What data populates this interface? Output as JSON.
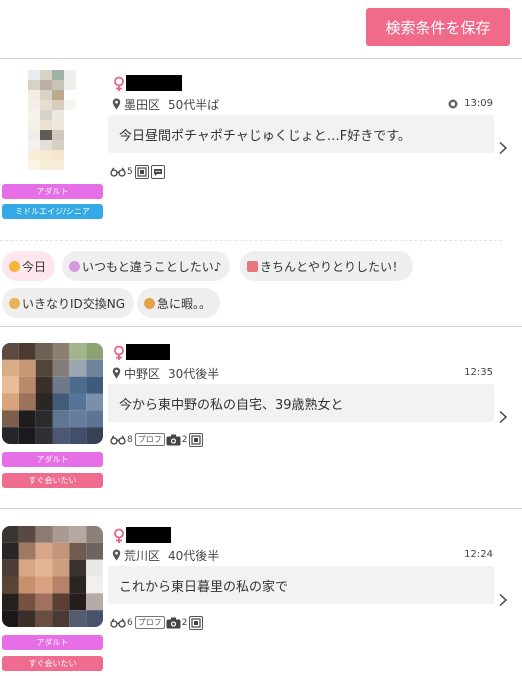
{
  "header": {
    "save_label": "検索条件を保存"
  },
  "posts": [
    {
      "location": "墨田区",
      "age": "50代半ば",
      "time": "13:09",
      "message": "今日昼間ポチャポチャじゅくじょと…F好きです。",
      "stats": {
        "glasses_count": "5"
      },
      "badges": [
        "アダルト",
        "ミドルエイジ/シニア"
      ]
    },
    {
      "location": "中野区",
      "age": "30代後半",
      "time": "12:35",
      "message": "今から東中野の私の自宅、39歳熟女と",
      "stats": {
        "glasses_count": "8",
        "prof_label": "プロフ",
        "photo_count": "2"
      },
      "badges": [
        "アダルト",
        "すぐ会いたい"
      ]
    },
    {
      "location": "荒川区",
      "age": "40代後半",
      "time": "12:24",
      "message": "これから東日暮里の私の家で",
      "stats": {
        "glasses_count": "6",
        "prof_label": "プロフ",
        "photo_count": "2"
      },
      "badges": [
        "アダルト",
        "すぐ会いたい"
      ]
    }
  ],
  "tags": [
    {
      "label": "今日",
      "icon": "smile-emoji",
      "color": "#f5b53b"
    },
    {
      "label": "いつもと違うことしたい♪",
      "icon": "party-emoji",
      "color": "#d89adf"
    },
    {
      "label": "きちんとやりとりしたい！",
      "icon": "letter-emoji",
      "color": "#e9747d"
    },
    {
      "label": "いきなりID交換NG",
      "icon": "person-emoji",
      "color": "#e8b25a"
    },
    {
      "label": "急に暇。。",
      "icon": "frown-emoji",
      "color": "#e5a347"
    }
  ],
  "colors": {
    "accent": "#f06a8a",
    "adult": "#e66ee6",
    "senior": "#35a9e5",
    "meet": "#ef6c8e",
    "female": "#e6648c"
  }
}
